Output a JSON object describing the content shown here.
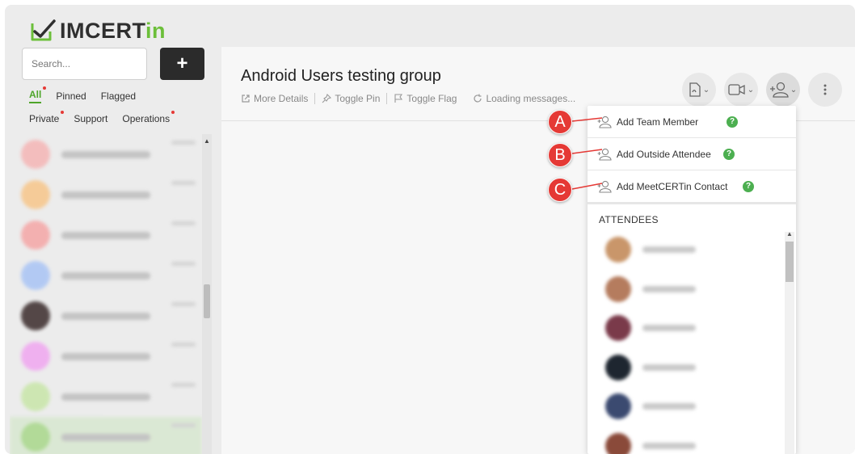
{
  "app": {
    "logo_text": "IMCERT",
    "logo_suffix": "in"
  },
  "sidebar": {
    "search_placeholder": "Search...",
    "add_label": "+",
    "filters_row1": [
      {
        "label": "All",
        "active": true,
        "dot": true
      },
      {
        "label": "Pinned",
        "active": false,
        "dot": false
      },
      {
        "label": "Flagged",
        "active": false,
        "dot": false
      }
    ],
    "filters_row2": [
      {
        "label": "Private",
        "dot": true
      },
      {
        "label": "Support",
        "dot": false
      },
      {
        "label": "Operations",
        "dot": true
      }
    ],
    "avatar_colors": [
      "#f5b5b5",
      "#f7c68a",
      "#f5a6a6",
      "#a9c4f5",
      "#3a2b2b",
      "#f0a6f0",
      "#c8e6a8",
      "#a8d88a"
    ]
  },
  "header": {
    "title": "Android Users testing group",
    "actions": [
      "More Details",
      "Toggle Pin",
      "Toggle Flag",
      "Loading messages..."
    ]
  },
  "dropdown": {
    "items": [
      {
        "label": "Add Team Member",
        "marker": "A"
      },
      {
        "label": "Add Outside Attendee",
        "marker": "B"
      },
      {
        "label": "Add MeetCERTin Contact",
        "marker": "C"
      }
    ],
    "help_glyph": "?",
    "attendees_heading": "ATTENDEES",
    "attendee_colors": [
      "#c9966a",
      "#b57c5e",
      "#7a3a4a",
      "#1e2630",
      "#3b4a70",
      "#8a4a3a"
    ]
  },
  "colors": {
    "accent": "#4ea52a",
    "marker": "#e53935",
    "help": "#4caf50"
  }
}
